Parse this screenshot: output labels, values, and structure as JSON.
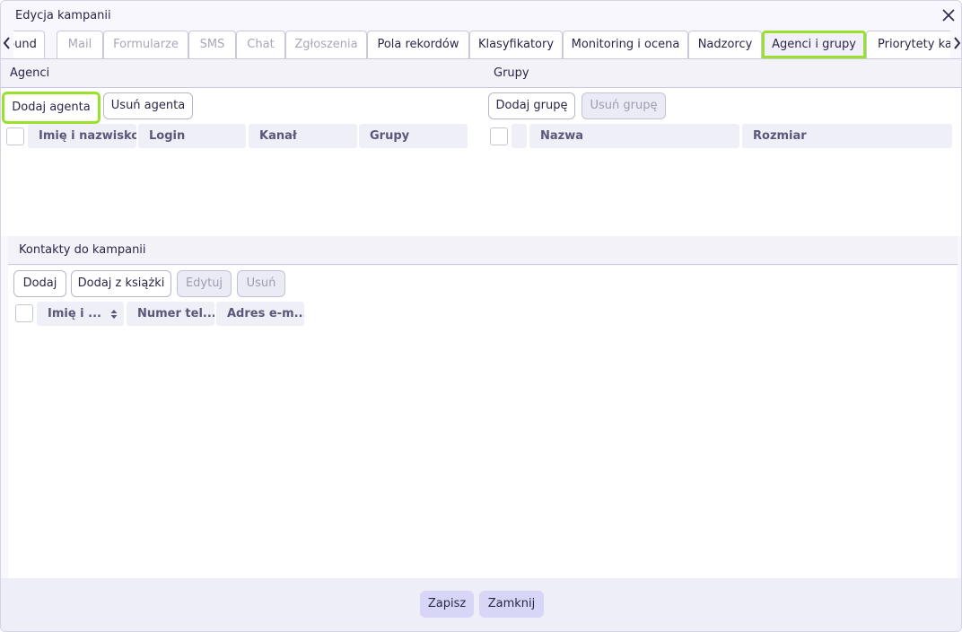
{
  "dialog": {
    "title": "Edycja kampanii",
    "close_icon": "close-icon"
  },
  "tabs": [
    {
      "label": "ound",
      "state": "normal"
    },
    {
      "label": "Mail",
      "state": "disabled"
    },
    {
      "label": "Formularze",
      "state": "disabled"
    },
    {
      "label": "SMS",
      "state": "disabled"
    },
    {
      "label": "Chat",
      "state": "disabled"
    },
    {
      "label": "Zgłoszenia",
      "state": "disabled"
    },
    {
      "label": "Pola rekordów",
      "state": "normal"
    },
    {
      "label": "Klasyfikatory",
      "state": "normal"
    },
    {
      "label": "Monitoring i ocena",
      "state": "normal"
    },
    {
      "label": "Nadzorcy",
      "state": "normal"
    },
    {
      "label": "Agenci i grupy",
      "state": "active"
    },
    {
      "label": "Priorytety kar",
      "state": "normal"
    }
  ],
  "agents": {
    "header": "Agenci",
    "add_button": "Dodaj agenta",
    "remove_button": "Usuń agenta",
    "columns": [
      "Imię i nazwisko",
      "Login",
      "Kanał",
      "Grupy"
    ]
  },
  "groups": {
    "header": "Grupy",
    "add_button": "Dodaj grupę",
    "remove_button": "Usuń grupę",
    "columns": [
      "Nazwa",
      "Rozmiar"
    ]
  },
  "contacts": {
    "header": "Kontakty do kampanii",
    "add_button": "Dodaj",
    "add_from_book_button": "Dodaj z książki",
    "edit_button": "Edytuj",
    "delete_button": "Usuń",
    "columns": [
      "Imię i ...",
      "Numer tel...",
      "Adres e-m..."
    ]
  },
  "footer": {
    "save_button": "Zapisz",
    "close_button": "Zamknij"
  },
  "colors": {
    "highlight": "#9ae12e",
    "primary_button": "#d8d6f7",
    "text": "#2a2747"
  }
}
